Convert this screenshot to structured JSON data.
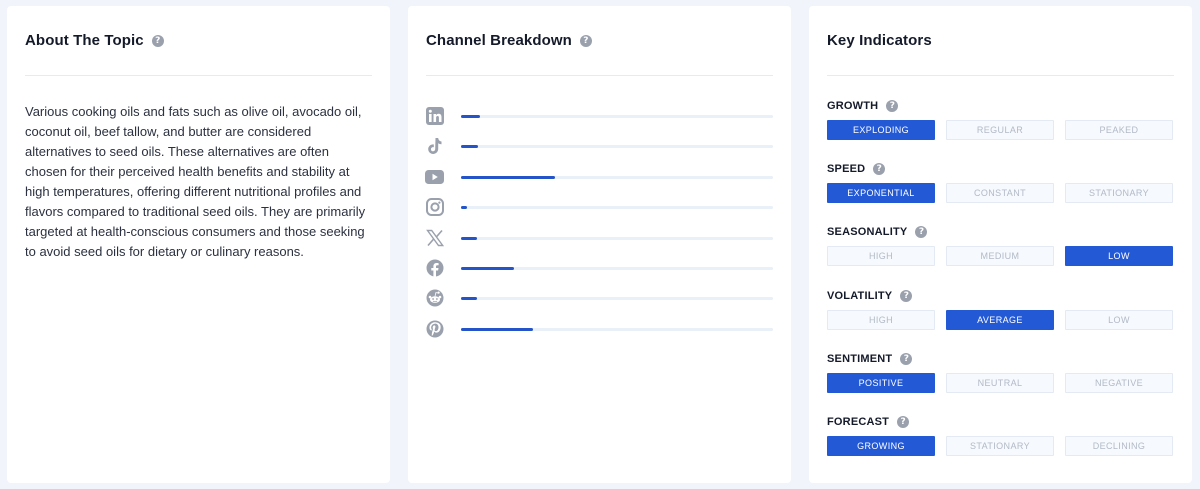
{
  "about": {
    "title": "About The Topic",
    "help": "?",
    "text": "Various cooking oils and fats such as olive oil, avocado oil, coconut oil, beef tallow, and butter are considered alternatives to seed oils. These alternatives are often chosen for their perceived health benefits and stability at high temperatures, offering different nutritional profiles and flavors compared to traditional seed oils. They are primarily targeted at health-conscious consumers and those seeking to avoid seed oils for dietary or culinary reasons."
  },
  "channel": {
    "title": "Channel Breakdown",
    "help": "?",
    "items": [
      {
        "icon": "linkedin-icon",
        "share": 0.06
      },
      {
        "icon": "tiktok-icon",
        "share": 0.055
      },
      {
        "icon": "youtube-icon",
        "share": 0.3
      },
      {
        "icon": "instagram-icon",
        "share": 0.02
      },
      {
        "icon": "x-icon",
        "share": 0.05
      },
      {
        "icon": "facebook-icon",
        "share": 0.17
      },
      {
        "icon": "reddit-icon",
        "share": 0.05
      },
      {
        "icon": "pinterest-icon",
        "share": 0.23
      }
    ],
    "bar_color": "#2454c8"
  },
  "indicators": {
    "title": "Key Indicators",
    "accent": "#2459d6",
    "groups": [
      {
        "label": "GROWTH",
        "options": [
          "EXPLODING",
          "REGULAR",
          "PEAKED"
        ],
        "selected": 0
      },
      {
        "label": "SPEED",
        "options": [
          "EXPONENTIAL",
          "CONSTANT",
          "STATIONARY"
        ],
        "selected": 0
      },
      {
        "label": "SEASONALITY",
        "options": [
          "HIGH",
          "MEDIUM",
          "LOW"
        ],
        "selected": 2
      },
      {
        "label": "VOLATILITY",
        "options": [
          "HIGH",
          "AVERAGE",
          "LOW"
        ],
        "selected": 1
      },
      {
        "label": "SENTIMENT",
        "options": [
          "POSITIVE",
          "NEUTRAL",
          "NEGATIVE"
        ],
        "selected": 0
      },
      {
        "label": "FORECAST",
        "options": [
          "GROWING",
          "STATIONARY",
          "DECLINING"
        ],
        "selected": 0
      }
    ]
  }
}
